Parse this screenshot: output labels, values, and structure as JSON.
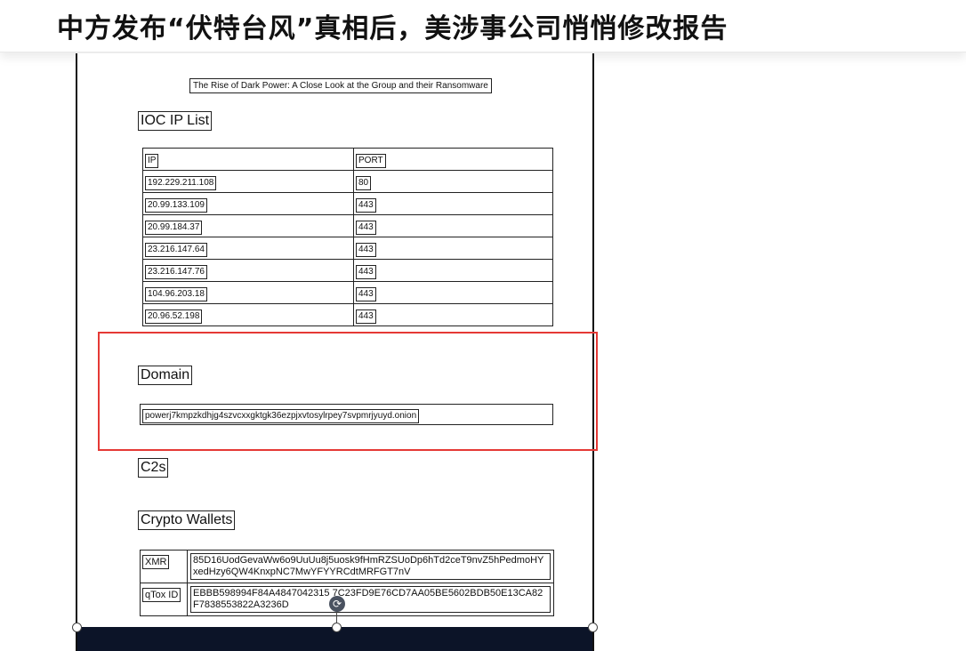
{
  "headline": "中方发布“伏特台风”真相后，美涉事公司悄悄修改报告",
  "document": {
    "title": "The Rise of Dark Power: A Close Look at the Group and their Ransomware",
    "ioc_heading": "IOC IP List",
    "ip_table": {
      "headers": [
        "IP",
        "PORT"
      ],
      "rows": [
        [
          "192.229.211.108",
          "80"
        ],
        [
          "20.99.133.109",
          "443"
        ],
        [
          "20.99.184.37",
          "443"
        ],
        [
          "23.216.147.64",
          "443"
        ],
        [
          "23.216.147.76",
          "443"
        ],
        [
          "104.96.203.18",
          "443"
        ],
        [
          "20.96.52.198",
          "443"
        ]
      ]
    },
    "domain_heading": "Domain",
    "domain_value": "powerj7kmpzkdhjg4szvcxxgktgk36ezpjxvtosylrpey7svpmrjyuyd.onion",
    "c2_heading": "C2s",
    "crypto_heading": "Crypto Wallets",
    "wallets": [
      {
        "label": "XMR",
        "value": "85D16UodGevaWw6o9UuUu8j5uosk9fHmRZSUoDp6hTd2ceT9nvZ5hPedmoHYxedHzy6QW4KnxpNC7MwYFYYRCdtMRFGT7nV"
      },
      {
        "label": "qTox ID",
        "value": "EBBB598994F84A4847042315 7C23FD9E76CD7AA05BE5602BDB50E13CA82F7838553822A3236D"
      }
    ]
  },
  "icons": {
    "rotate": "rotate-icon",
    "rotate_glyph": "⟳"
  },
  "colors": {
    "highlight": "#e53935",
    "band": "#0c1428"
  }
}
